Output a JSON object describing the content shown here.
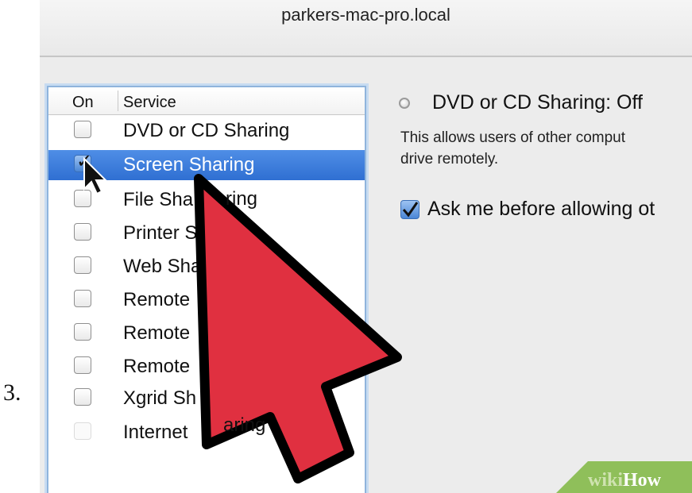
{
  "step_number": "3.",
  "window": {
    "title": "parkers-mac-pro.local"
  },
  "service_list": {
    "columns": {
      "on": "On",
      "service": "Service"
    },
    "items": [
      {
        "label": "DVD or CD Sharing",
        "checked": false,
        "selected": false
      },
      {
        "label": "Screen Sharing",
        "checked": true,
        "selected": true
      },
      {
        "label": "File Sha",
        "checked": false,
        "selected": false
      },
      {
        "label": "Printer S",
        "checked": false,
        "selected": false
      },
      {
        "label": "Web Sha",
        "checked": false,
        "selected": false
      },
      {
        "label": "Remote",
        "checked": false,
        "selected": false
      },
      {
        "label": "Remote",
        "checked": false,
        "selected": false
      },
      {
        "label": "Remote",
        "checked": false,
        "selected": false
      },
      {
        "label": "Xgrid Sh",
        "checked": false,
        "selected": false
      },
      {
        "label": "Internet",
        "checked": false,
        "selected": false,
        "dim": true
      }
    ],
    "partial_texts": {
      "file_sharing_tail": "ring",
      "internet_sharing_tail": "aring"
    }
  },
  "detail": {
    "status": "DVD or CD Sharing: Off",
    "description_line1": "This allows users of other comput",
    "description_line2": "drive remotely.",
    "ask_label": "Ask me before allowing ot",
    "ask_checked": true
  },
  "colors": {
    "selection": "#3b78d8",
    "arrow_fill": "#e03040",
    "arrow_outline": "#000000"
  },
  "watermark": {
    "wiki": "wiki",
    "how": "How"
  }
}
